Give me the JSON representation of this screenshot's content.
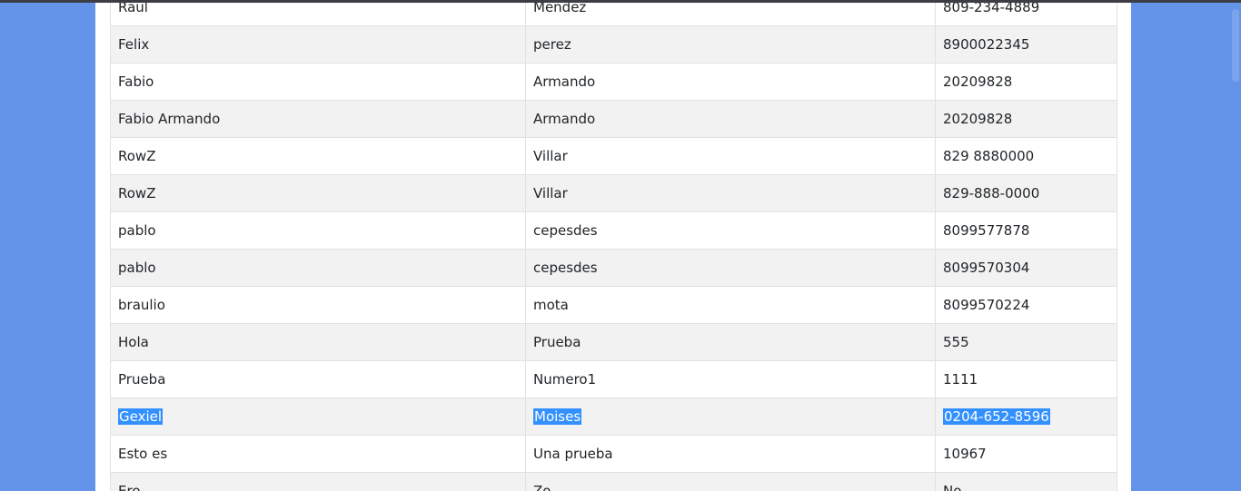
{
  "contacts": {
    "rows": [
      {
        "nombre": "Raul",
        "apellido": "Mendez",
        "telefono": "809-234-4889"
      },
      {
        "nombre": "Felix",
        "apellido": "perez",
        "telefono": "8900022345"
      },
      {
        "nombre": "Fabio",
        "apellido": "Armando",
        "telefono": "20209828"
      },
      {
        "nombre": "Fabio Armando",
        "apellido": "Armando",
        "telefono": "20209828"
      },
      {
        "nombre": "RowZ",
        "apellido": "Villar",
        "telefono": "829 8880000"
      },
      {
        "nombre": "RowZ",
        "apellido": "Villar",
        "telefono": "829-888-0000"
      },
      {
        "nombre": "pablo",
        "apellido": "cepesdes",
        "telefono": "8099577878"
      },
      {
        "nombre": "pablo",
        "apellido": "cepesdes",
        "telefono": "8099570304"
      },
      {
        "nombre": "braulio",
        "apellido": "mota",
        "telefono": "8099570224"
      },
      {
        "nombre": "Hola",
        "apellido": "Prueba",
        "telefono": "555"
      },
      {
        "nombre": "Prueba",
        "apellido": "Numero1",
        "telefono": "1111"
      },
      {
        "nombre": "Gexiel",
        "apellido": "Moises",
        "telefono": "0204-652-8596"
      },
      {
        "nombre": "Esto es",
        "apellido": "Una prueba",
        "telefono": "10967"
      },
      {
        "nombre": "Ero",
        "apellido": "Zo",
        "telefono": "No"
      }
    ]
  },
  "colors": {
    "background": "#6494ea",
    "stripe": "#f2f2f2",
    "selection": "#3390ff"
  }
}
